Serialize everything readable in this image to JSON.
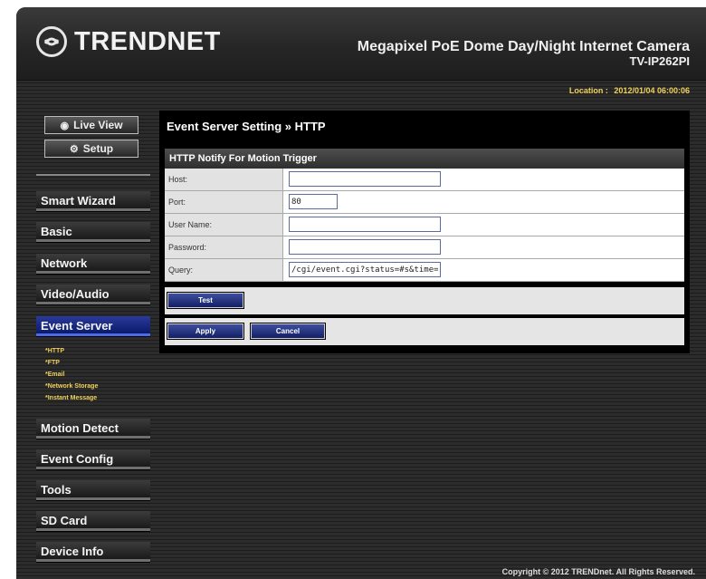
{
  "header": {
    "brand": "TRENDNET",
    "product_name": "Megapixel PoE Dome Day/Night Internet Camera",
    "model": "TV-IP262PI"
  },
  "location": {
    "label": "Location :",
    "value": "2012/01/04 06:00:06"
  },
  "sidebar": {
    "top_buttons": [
      {
        "label": "Live View",
        "icon": "live-view-icon"
      },
      {
        "label": "Setup",
        "icon": "gear-icon"
      }
    ],
    "menu": [
      {
        "label": "Smart Wizard"
      },
      {
        "label": "Basic"
      },
      {
        "label": "Network"
      },
      {
        "label": "Video/Audio"
      },
      {
        "label": "Event Server",
        "active": true
      },
      {
        "label": "Motion Detect"
      },
      {
        "label": "Event Config"
      },
      {
        "label": "Tools"
      },
      {
        "label": "SD Card"
      },
      {
        "label": "Device Info"
      }
    ],
    "sub_links": [
      "*HTTP",
      "*FTP",
      "*Email",
      "*Network Storage",
      "*Instant Message"
    ]
  },
  "main": {
    "title": "Event Server Setting » HTTP",
    "section_title": "HTTP Notify For Motion Trigger",
    "fields": {
      "host": {
        "label": "Host:",
        "value": ""
      },
      "port": {
        "label": "Port:",
        "value": "80"
      },
      "user_name": {
        "label": "User Name:",
        "value": ""
      },
      "password": {
        "label": "Password:",
        "value": ""
      },
      "query": {
        "label": "Query:",
        "value": "/cgi/event.cgi?status=#s&time=#t"
      }
    },
    "test_label": "Test",
    "apply_label": "Apply",
    "cancel_label": "Cancel"
  },
  "footer": {
    "copyright": "Copyright © 2012 TRENDnet. All Rights Reserved."
  },
  "colors": {
    "accent_blue": "#1a2a80",
    "highlight_yellow": "#f0d25a"
  }
}
